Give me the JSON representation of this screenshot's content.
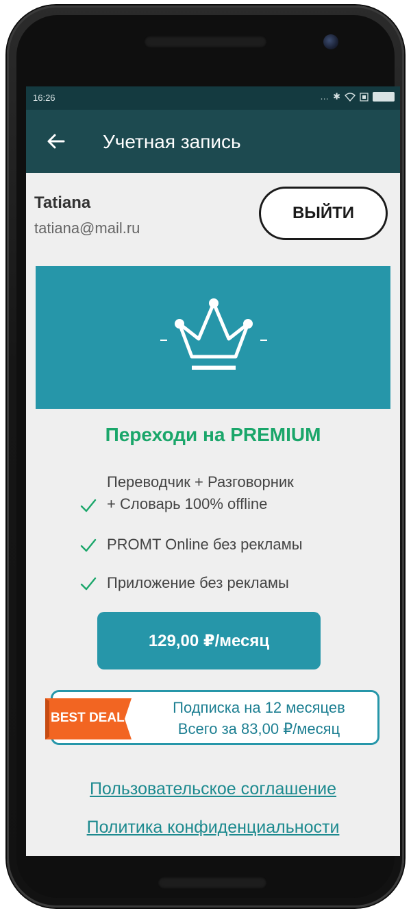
{
  "status_bar": {
    "time": "16:26",
    "icons": [
      "more-icon",
      "bluetooth-icon",
      "wifi-icon",
      "sim-icon",
      "battery-icon"
    ]
  },
  "app_bar": {
    "title": "Учетная запись",
    "back_icon": "arrow-left-icon"
  },
  "account": {
    "name": "Tatiana",
    "email": "tatiana@mail.ru",
    "logout_label": "ВЫЙТИ"
  },
  "premium": {
    "banner_icon": "crown-icon",
    "title": "Переходи на PREMIUM",
    "features": [
      {
        "line1": "Переводчик + Разговорник",
        "line2": "+ Словарь 100% offline"
      },
      {
        "line1": "PROMT Online без рекламы"
      },
      {
        "line1": "Приложение без рекламы"
      }
    ],
    "price_label": "129,00 ₽/месяц"
  },
  "deal": {
    "badge": "BEST DEAL",
    "line1": "Подписка на 12 месяцев",
    "line2": "Всего за 83,00 ₽/месяц"
  },
  "links": {
    "terms": "Пользовательское соглашение",
    "privacy": "Политика конфиденциальности"
  },
  "colors": {
    "app_bar": "#1d4a50",
    "accent": "#2696a9",
    "premium_green": "#1aa66a",
    "badge_orange": "#f26522"
  }
}
